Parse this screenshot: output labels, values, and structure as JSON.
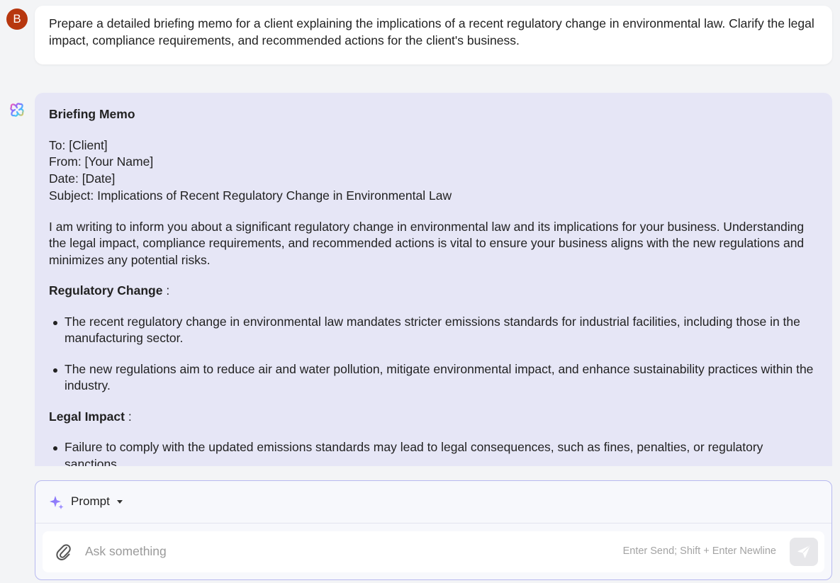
{
  "user_message": {
    "avatar_letter": "B",
    "avatar_color": "#b7370f",
    "text": "Prepare a detailed briefing memo for a client explaining the implications of a recent regulatory change in environmental law. Clarify the legal impact, compliance requirements, and recommended actions for the client's business."
  },
  "assistant_message": {
    "avatar_icon": "ai-logo-icon",
    "title": "Briefing Memo",
    "meta": [
      "To: [Client]",
      "From: [Your Name]",
      "Date: [Date]",
      "Subject: Implications of Recent Regulatory Change in Environmental Law"
    ],
    "intro": "I am writing to inform you about a significant regulatory change in environmental law and its implications for your business. Understanding the legal impact, compliance requirements, and recommended actions is vital to ensure your business aligns with the new regulations and minimizes any potential risks.",
    "sections": [
      {
        "heading": "Regulatory Change",
        "suffix": " :",
        "bullets": [
          "The recent regulatory change in environmental law mandates stricter emissions standards for industrial facilities, including those in the manufacturing sector.",
          "The new regulations aim to reduce air and water pollution, mitigate environmental impact, and enhance sustainability practices within the industry."
        ]
      },
      {
        "heading": "Legal Impact",
        "suffix": " :",
        "bullets": [
          "Failure to comply with the updated emissions standards may lead to legal consequences, such as fines, penalties, or regulatory sanctions."
        ]
      }
    ]
  },
  "composer": {
    "mode_label": "Prompt",
    "mode_icon": "sparkle-icon",
    "placeholder": "Ask something",
    "hint": "Enter Send; Shift + Enter Newline",
    "accent_color": "#b7b9f0"
  },
  "colors": {
    "background": "#f3f4f6",
    "assistant_bubble": "#e6e6f6",
    "user_bubble": "#ffffff"
  }
}
